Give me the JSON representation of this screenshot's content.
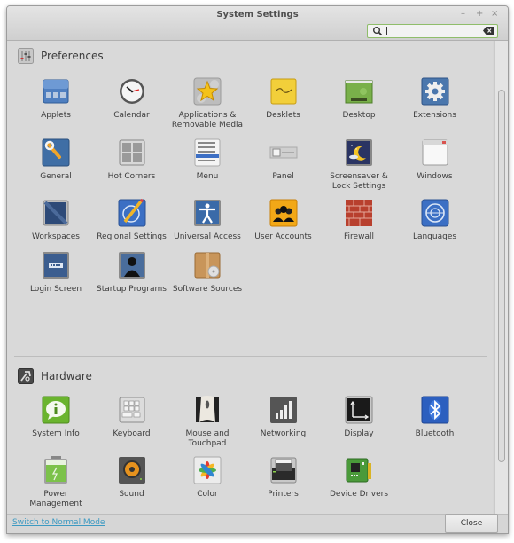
{
  "window": {
    "title": "System Settings",
    "controls": {
      "minimize": "–",
      "maximize": "+",
      "close": "×"
    }
  },
  "search": {
    "value": "",
    "placeholder": ""
  },
  "sections": {
    "preferences": {
      "title": "Preferences",
      "items": [
        {
          "label": "Applets",
          "icon": "applets-icon"
        },
        {
          "label": "Calendar",
          "icon": "calendar-clock-icon"
        },
        {
          "label": "Applications & Removable Media",
          "icon": "star-icon"
        },
        {
          "label": "Desklets",
          "icon": "desklets-note-icon"
        },
        {
          "label": "Desktop",
          "icon": "desktop-icon"
        },
        {
          "label": "Extensions",
          "icon": "gear-icon"
        },
        {
          "label": "General",
          "icon": "wrench-icon"
        },
        {
          "label": "Hot Corners",
          "icon": "hot-corners-icon"
        },
        {
          "label": "Menu",
          "icon": "menu-list-icon"
        },
        {
          "label": "Panel",
          "icon": "panel-icon"
        },
        {
          "label": "Screensaver & Lock Settings",
          "icon": "moon-night-icon"
        },
        {
          "label": "Windows",
          "icon": "window-icon"
        },
        {
          "label": "Workspaces",
          "icon": "workspaces-icon"
        },
        {
          "label": "Regional Settings",
          "icon": "globe-pencil-icon"
        },
        {
          "label": "Universal Access",
          "icon": "accessibility-icon"
        },
        {
          "label": "User Accounts",
          "icon": "users-icon"
        },
        {
          "label": "Firewall",
          "icon": "brick-wall-icon"
        },
        {
          "label": "Languages",
          "icon": "globe-icon"
        },
        {
          "label": "Login Screen",
          "icon": "login-screen-icon"
        },
        {
          "label": "Startup Programs",
          "icon": "person-silhouette-icon"
        },
        {
          "label": "Software Sources",
          "icon": "package-box-icon"
        }
      ]
    },
    "hardware": {
      "title": "Hardware",
      "items": [
        {
          "label": "System Info",
          "icon": "info-bubble-icon"
        },
        {
          "label": "Keyboard",
          "icon": "keyboard-icon"
        },
        {
          "label": "Mouse and Touchpad",
          "icon": "mouse-icon"
        },
        {
          "label": "Networking",
          "icon": "signal-bars-icon"
        },
        {
          "label": "Display",
          "icon": "display-icon"
        },
        {
          "label": "Bluetooth",
          "icon": "bluetooth-icon"
        },
        {
          "label": "Power Management",
          "icon": "battery-icon"
        },
        {
          "label": "Sound",
          "icon": "speaker-icon"
        },
        {
          "label": "Color",
          "icon": "color-wheel-icon"
        },
        {
          "label": "Printers",
          "icon": "printer-icon"
        },
        {
          "label": "Device Drivers",
          "icon": "circuit-board-icon"
        }
      ]
    }
  },
  "footer": {
    "switch_mode_link": "Switch to Normal Mode",
    "close_button": "Close"
  },
  "colors": {
    "link": "#3d9ac2",
    "search_border": "#8fbd6a"
  }
}
